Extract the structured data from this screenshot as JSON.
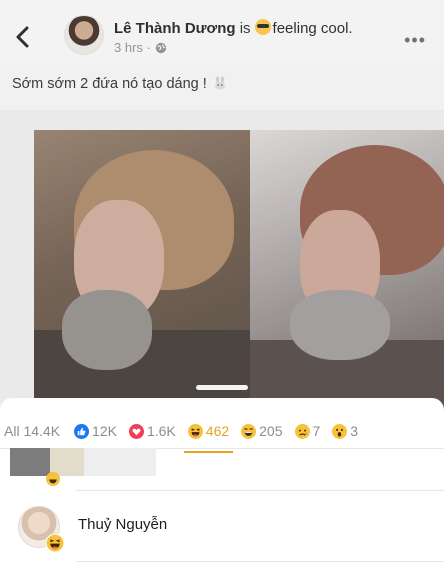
{
  "post": {
    "author": "Lê Thành Dương",
    "is_word": "is",
    "feeling": "feeling cool.",
    "time": "3 hrs ·",
    "caption": "Sớm sớm 2 đứa nó tạo dáng !",
    "icons": {
      "back": "back-chevron-icon",
      "privacy": "globe-icon",
      "more": "more-options-icon",
      "feeling": "cool-sunglasses-emoji",
      "caption_emoji": "bunny-emoji"
    }
  },
  "reactions": {
    "tabs": [
      {
        "label": "All 14.4K",
        "icon": "",
        "active": false
      },
      {
        "label": "12K",
        "icon": "like-icon",
        "active": false
      },
      {
        "label": "1.6K",
        "icon": "love-icon",
        "active": false
      },
      {
        "label": "462",
        "icon": "haha-icon",
        "active": true
      },
      {
        "label": "205",
        "icon": "wow-icon",
        "active": false
      },
      {
        "label": "7",
        "icon": "sad-icon",
        "active": false
      },
      {
        "label": "3",
        "icon": "angry-icon",
        "active": false
      }
    ],
    "colors": {
      "active_tab": "#e5a322",
      "like": "#1877f2",
      "love": "#f33e58",
      "yellow": "#f7c23b"
    }
  },
  "people": [
    {
      "name": "Thuỷ Nguyễn",
      "reaction": "haha-icon"
    }
  ]
}
